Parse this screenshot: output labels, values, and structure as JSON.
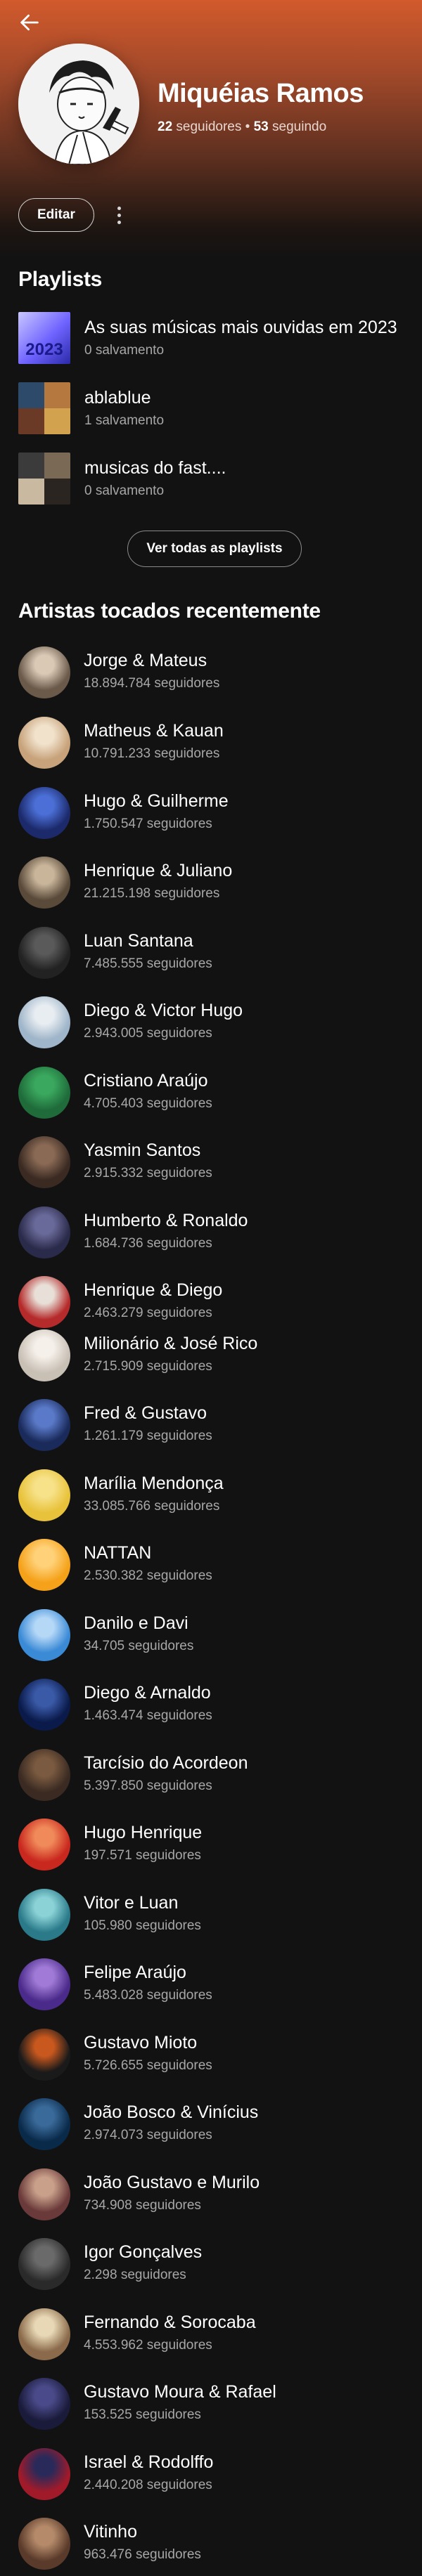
{
  "profile": {
    "name": "Miquéias Ramos",
    "followers_count": "22",
    "followers_label": "seguidores",
    "separator": "•",
    "following_count": "53",
    "following_label": "seguindo",
    "accent_color": "#d25a2c"
  },
  "actions": {
    "edit_label": "Editar",
    "back_icon": "arrow-left-icon",
    "more_icon": "more-vertical-icon"
  },
  "playlists": {
    "title": "Playlists",
    "items": [
      {
        "title": "As suas músicas mais ouvidas em 2023",
        "subtitle": "0 salvamento",
        "cover_text": "2023"
      },
      {
        "title": "ablablue",
        "subtitle": "1 salvamento"
      },
      {
        "title": "musicas do fast....",
        "subtitle": "0 salvamento"
      }
    ],
    "view_all_label": "Ver todas as playlists"
  },
  "artists": {
    "title": "Artistas tocados recentemente",
    "items": [
      {
        "name": "Jorge & Mateus",
        "followers": "18.894.784 seguidores"
      },
      {
        "name": "Matheus & Kauan",
        "followers": "10.791.233 seguidores"
      },
      {
        "name": "Hugo & Guilherme",
        "followers": "1.750.547 seguidores"
      },
      {
        "name": "Henrique & Juliano",
        "followers": "21.215.198 seguidores"
      },
      {
        "name": "Luan Santana",
        "followers": "7.485.555 seguidores"
      },
      {
        "name": "Diego & Victor Hugo",
        "followers": "2.943.005 seguidores"
      },
      {
        "name": "Cristiano Araújo",
        "followers": "4.705.403 seguidores"
      },
      {
        "name": "Yasmin Santos",
        "followers": "2.915.332 seguidores"
      },
      {
        "name": "Humberto & Ronaldo",
        "followers": "1.684.736 seguidores"
      },
      {
        "name": "Henrique & Diego",
        "followers": "2.463.279 seguidores"
      },
      {
        "name": "Milionário & José Rico",
        "followers": "2.715.909 seguidores"
      },
      {
        "name": "Fred & Gustavo",
        "followers": "1.261.179 seguidores"
      },
      {
        "name": "Marília Mendonça",
        "followers": "33.085.766 seguidores"
      },
      {
        "name": "NATTAN",
        "followers": "2.530.382 seguidores"
      },
      {
        "name": "Danilo e Davi",
        "followers": "34.705 seguidores"
      },
      {
        "name": "Diego & Arnaldo",
        "followers": "1.463.474 seguidores"
      },
      {
        "name": "Tarcísio do Acordeon",
        "followers": "5.397.850 seguidores"
      },
      {
        "name": "Hugo Henrique",
        "followers": "197.571 seguidores"
      },
      {
        "name": "Vitor e Luan",
        "followers": "105.980 seguidores"
      },
      {
        "name": "Felipe Araújo",
        "followers": "5.483.028 seguidores"
      },
      {
        "name": "Gustavo Mioto",
        "followers": "5.726.655 seguidores"
      },
      {
        "name": "João Bosco & Vinícius",
        "followers": "2.974.073 seguidores"
      },
      {
        "name": "João Gustavo e Murilo",
        "followers": "734.908 seguidores"
      },
      {
        "name": "Igor Gonçalves",
        "followers": "2.298 seguidores"
      },
      {
        "name": "Fernando & Sorocaba",
        "followers": "4.553.962 seguidores"
      },
      {
        "name": "Gustavo Moura & Rafael",
        "followers": "153.525 seguidores"
      },
      {
        "name": "Israel & Rodolffo",
        "followers": "2.440.208 seguidores"
      },
      {
        "name": "Vitinho",
        "followers": "963.476 seguidores"
      }
    ]
  }
}
